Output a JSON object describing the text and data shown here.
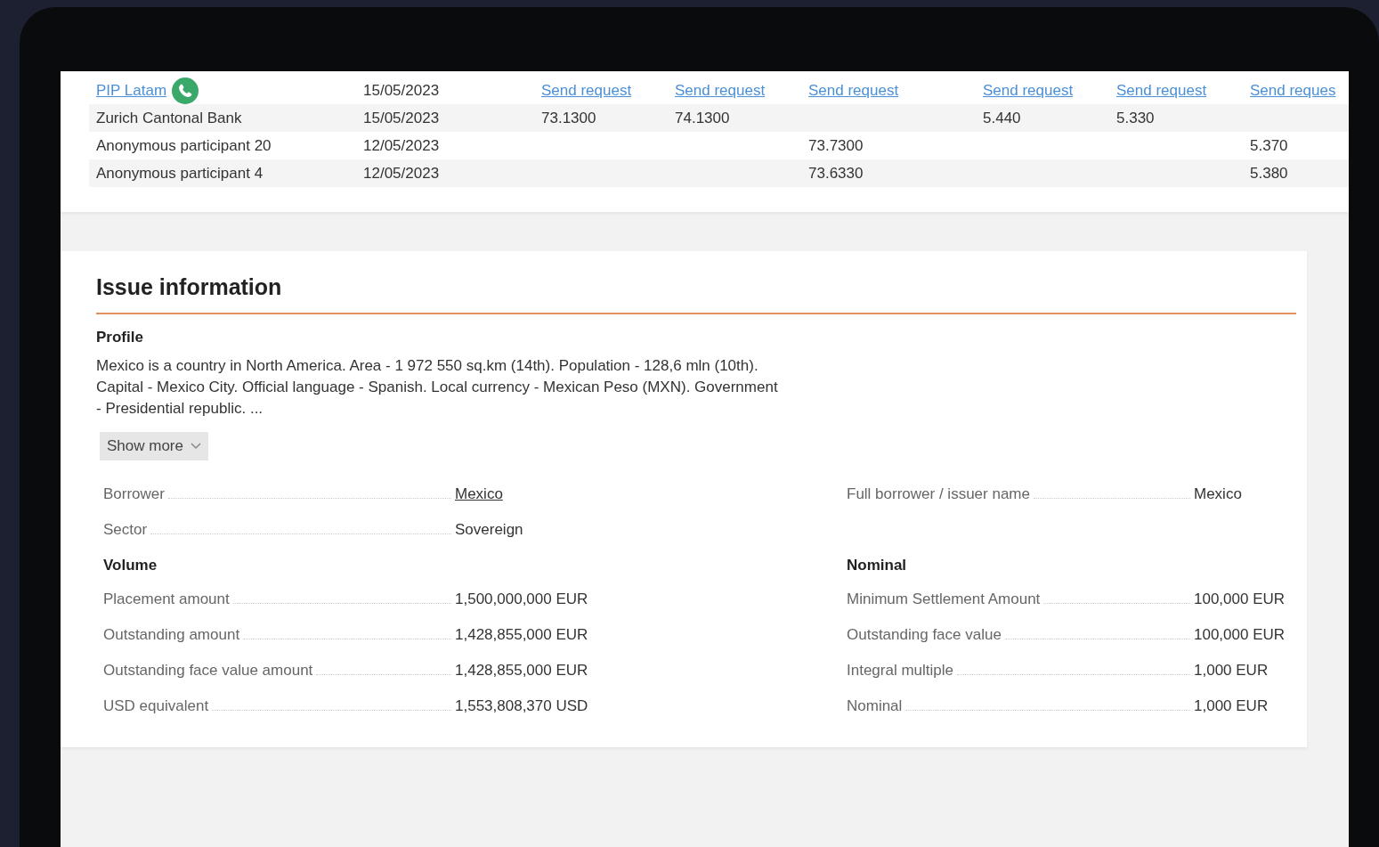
{
  "table": {
    "rows": [
      {
        "kind": "request",
        "participant": "PIP Latam",
        "phone": true,
        "date": "15/05/2023",
        "cells": [
          "Send request",
          "Send request",
          "Send request",
          "Send request",
          "Send request",
          "Send reques"
        ]
      },
      {
        "kind": "quote",
        "participant": "Zurich Cantonal Bank",
        "phone": false,
        "date": "15/05/2023",
        "cells": [
          "73.1300",
          "74.1300",
          null,
          "5.440",
          "5.330",
          null
        ]
      },
      {
        "kind": "quote",
        "participant": "Anonymous participant 20",
        "phone": false,
        "date": "12/05/2023",
        "cells": [
          null,
          null,
          "73.7300",
          null,
          null,
          "5.370"
        ]
      },
      {
        "kind": "quote",
        "participant": "Anonymous participant 4",
        "phone": false,
        "date": "12/05/2023",
        "cells": [
          null,
          null,
          "73.6330",
          null,
          null,
          "5.380"
        ]
      }
    ]
  },
  "issue": {
    "title": "Issue information",
    "profile": {
      "heading": "Profile",
      "text": "Mexico is a country in North America. Area - 1 972 550 sq.km (14th). Population - 128,6 mln (10th). Capital - Mexico City. Official language - Spanish. Local currency - Mexican Peso (MXN). Government - Presidential republic. ...",
      "show_more": "Show more"
    },
    "fields_left": [
      {
        "label": "Borrower",
        "value": "Mexico",
        "link": true
      },
      {
        "label": "Sector",
        "value": "Sovereign",
        "link": false
      }
    ],
    "fields_right": [
      {
        "label": "Full borrower / issuer name",
        "value": "Mexico",
        "link": false
      }
    ],
    "volume": {
      "heading": "Volume",
      "rows": [
        {
          "label": "Placement amount",
          "value": "1,500,000,000 EUR"
        },
        {
          "label": "Outstanding amount",
          "value": "1,428,855,000 EUR"
        },
        {
          "label": "Outstanding face value amount",
          "value": "1,428,855,000 EUR"
        },
        {
          "label": "USD equivalent",
          "value": "1,553,808,370 USD"
        }
      ]
    },
    "nominal": {
      "heading": "Nominal",
      "rows": [
        {
          "label": "Minimum Settlement Amount",
          "value": "100,000 EUR"
        },
        {
          "label": "Outstanding face value",
          "value": "100,000 EUR"
        },
        {
          "label": "Integral multiple",
          "value": "1,000 EUR"
        },
        {
          "label": "Nominal",
          "value": "1,000 EUR"
        }
      ]
    }
  }
}
